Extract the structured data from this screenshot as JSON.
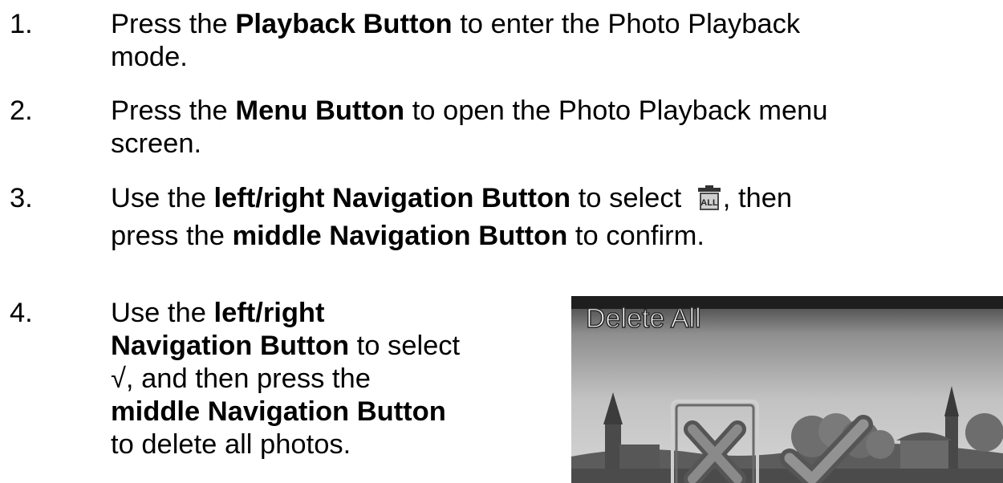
{
  "steps": [
    {
      "number": "1.",
      "lines": [
        [
          {
            "t": "Press the ",
            "b": false
          },
          {
            "t": "Playback Button",
            "b": true
          },
          {
            "t": " to enter the Photo Playback",
            "b": false
          }
        ],
        [
          {
            "t": "mode.",
            "b": false
          }
        ]
      ]
    },
    {
      "number": "2.",
      "lines": [
        [
          {
            "t": "Press the ",
            "b": false
          },
          {
            "t": "Menu Button",
            "b": true
          },
          {
            "t": " to open the Photo Playback menu",
            "b": false
          }
        ],
        [
          {
            "t": "screen.",
            "b": false
          }
        ]
      ]
    },
    {
      "number": "3.",
      "lines": [
        [
          {
            "t": "Use the ",
            "b": false
          },
          {
            "t": "left/right Navigation Button",
            "b": true
          },
          {
            "t": " to select ",
            "b": false
          },
          {
            "icon": "delete-all-icon"
          },
          {
            "t": ", then",
            "b": false
          }
        ],
        [
          {
            "t": "press the ",
            "b": false
          },
          {
            "t": "middle Navigation Button",
            "b": true
          },
          {
            "t": " to confirm.",
            "b": false
          }
        ]
      ]
    },
    {
      "number": "4.",
      "lines": [
        [
          {
            "t": "Use the ",
            "b": false
          },
          {
            "t": "left/right",
            "b": true
          }
        ],
        [
          {
            "t": "Navigation Button",
            "b": true
          },
          {
            "t": " to select",
            "b": false
          }
        ],
        [
          {
            "t": "√, and then press the",
            "b": false
          }
        ],
        [
          {
            "t": "middle Navigation Button",
            "b": true
          }
        ],
        [
          {
            "t": "to delete all photos.",
            "b": false
          }
        ]
      ]
    }
  ],
  "screen": {
    "title": "Delete All",
    "options": [
      "cancel-x-icon",
      "confirm-check-icon"
    ],
    "selected_option": "cancel-x-icon"
  }
}
